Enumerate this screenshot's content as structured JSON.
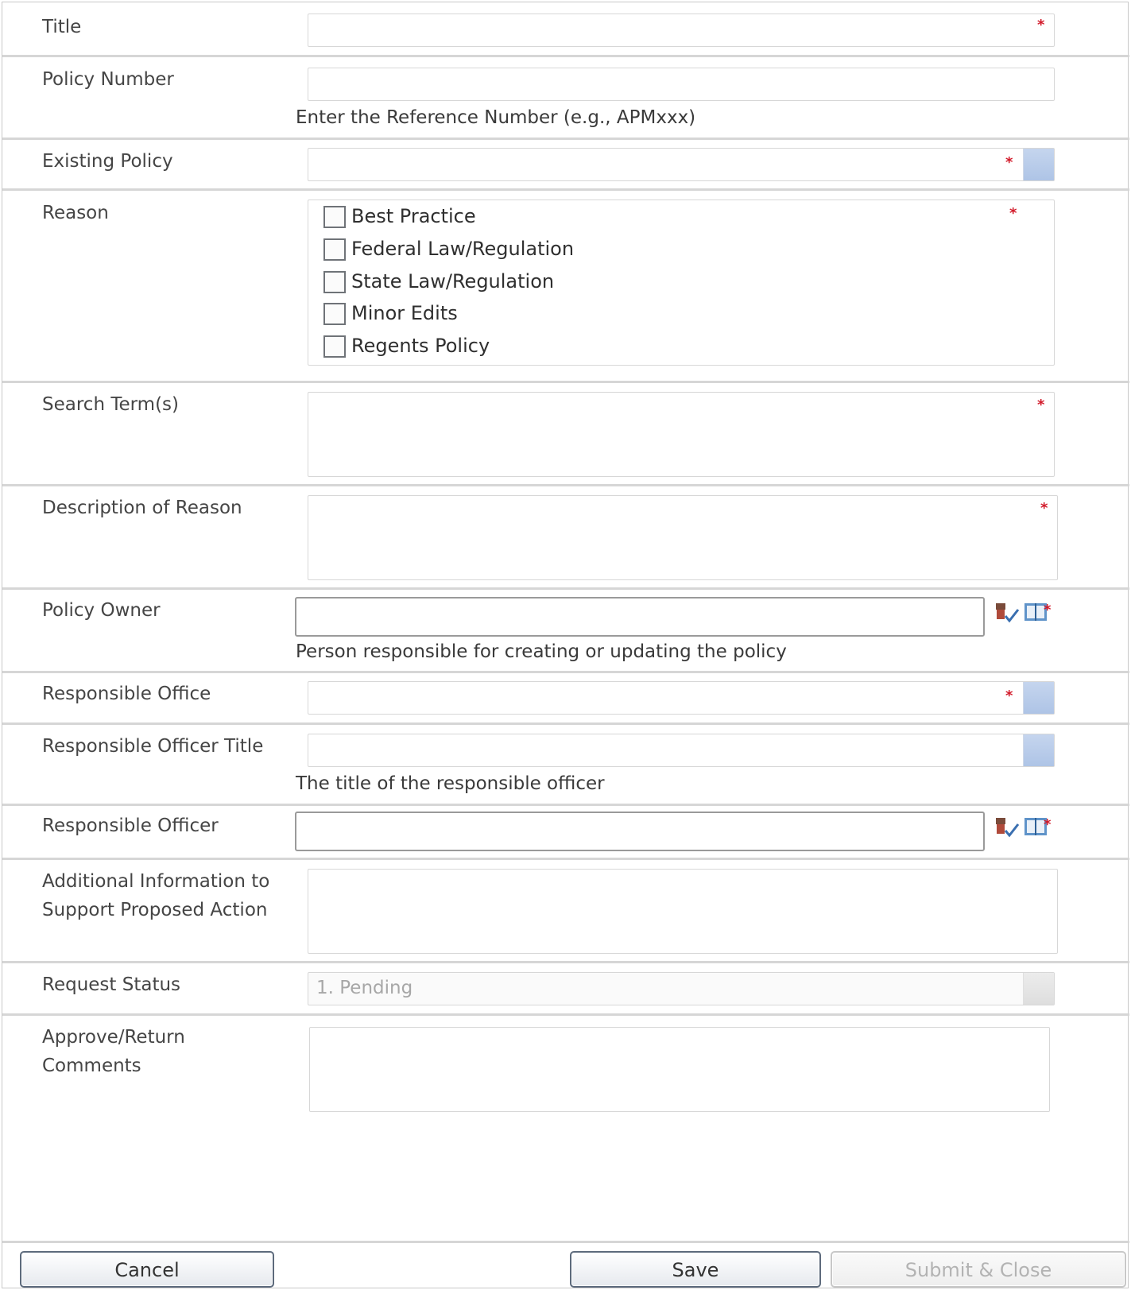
{
  "fields": {
    "title": {
      "label": "Title",
      "required": "*"
    },
    "policy_number": {
      "label": "Policy Number",
      "help": "Enter the Reference Number (e.g., APMxxx)"
    },
    "existing_policy": {
      "label": "Existing Policy",
      "required": "*"
    },
    "reason": {
      "label": "Reason",
      "required": "*",
      "options": [
        "Best Practice",
        "Federal Law/Regulation",
        "State Law/Regulation",
        "Minor Edits",
        "Regents Policy"
      ]
    },
    "search_terms": {
      "label": "Search Term(s)",
      "required": "*"
    },
    "description": {
      "label": "Description of Reason",
      "required": "*"
    },
    "policy_owner": {
      "label": "Policy Owner",
      "help": "Person responsible for creating or updating the policy",
      "required": "*"
    },
    "responsible_office": {
      "label": "Responsible Office",
      "required": "*"
    },
    "responsible_officer_title": {
      "label": "Responsible Officer Title",
      "help": "The title of the responsible officer"
    },
    "responsible_officer": {
      "label": "Responsible Officer",
      "required": "*"
    },
    "additional_info": {
      "label_line1": "Additional Information to",
      "label_line2": "Support Proposed Action"
    },
    "request_status": {
      "label": "Request Status",
      "value": "1. Pending"
    },
    "approve_comments": {
      "label_line1": "Approve/Return",
      "label_line2": "Comments"
    }
  },
  "buttons": {
    "cancel": "Cancel",
    "save": "Save",
    "submit_close": "Submit & Close"
  },
  "icons": [
    "check-names-icon",
    "address-book-icon",
    "dropdown-icon"
  ],
  "colors": {
    "required": "#d21a2a",
    "dropdown_button": "#b7cbea"
  }
}
